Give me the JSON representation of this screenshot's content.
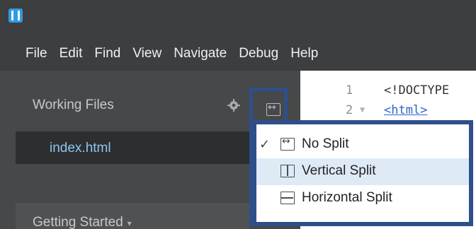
{
  "menubar": {
    "items": [
      "File",
      "Edit",
      "Find",
      "View",
      "Navigate",
      "Debug",
      "Help"
    ]
  },
  "sidebar": {
    "working_files_title": "Working Files",
    "file": "index.html",
    "getting_started": "Getting Started",
    "caret": "▾"
  },
  "editor": {
    "lines": [
      {
        "number": "1",
        "code": "<!DOCTYPE",
        "fold": ""
      },
      {
        "number": "2",
        "code": "<html>",
        "fold": "▼"
      }
    ]
  },
  "split_menu": {
    "items": [
      {
        "label": "No Split",
        "checked": true,
        "check": "✓"
      },
      {
        "label": "Vertical Split",
        "checked": false,
        "check": ""
      },
      {
        "label": "Horizontal Split",
        "checked": false,
        "check": ""
      }
    ]
  },
  "colors": {
    "accent_border": "#2f4f8a",
    "hover": "#dfeaf7",
    "file_link": "#8ec6f0"
  }
}
